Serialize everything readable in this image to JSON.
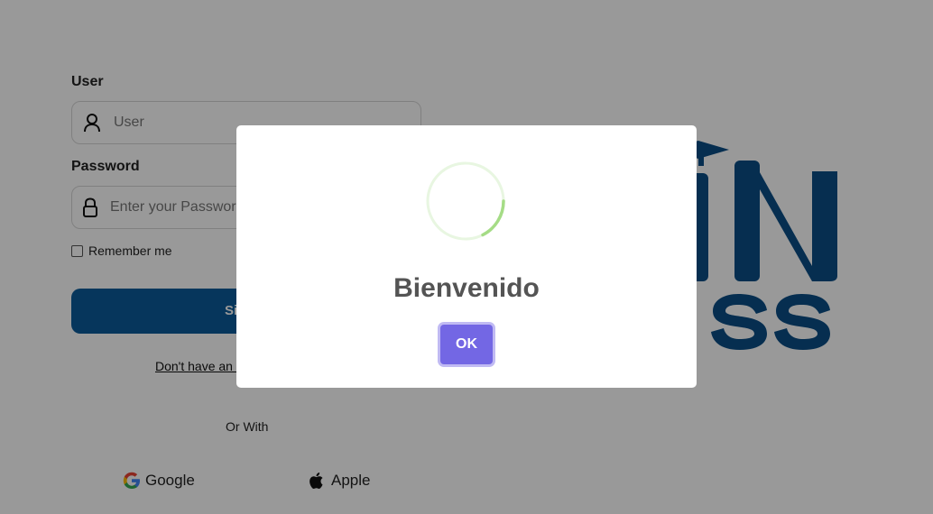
{
  "login": {
    "user_label": "User",
    "user_placeholder": "User",
    "password_label": "Password",
    "password_placeholder": "Enter your Password",
    "remember_label": "Remember me",
    "signin_label": "Sign In",
    "register_link": "Don't have an account? Register",
    "or_with": "Or With",
    "social": [
      {
        "label": "Google",
        "icon": "google-icon"
      },
      {
        "label": "Apple",
        "icon": "apple-icon"
      }
    ]
  },
  "logo": {
    "text_top": "IN",
    "text_bottom": "SS",
    "color": "#0b4e86"
  },
  "modal": {
    "title": "Bienvenido",
    "ok_label": "OK",
    "accent": "#7367e4",
    "spinner_color": "#a5dc86"
  }
}
